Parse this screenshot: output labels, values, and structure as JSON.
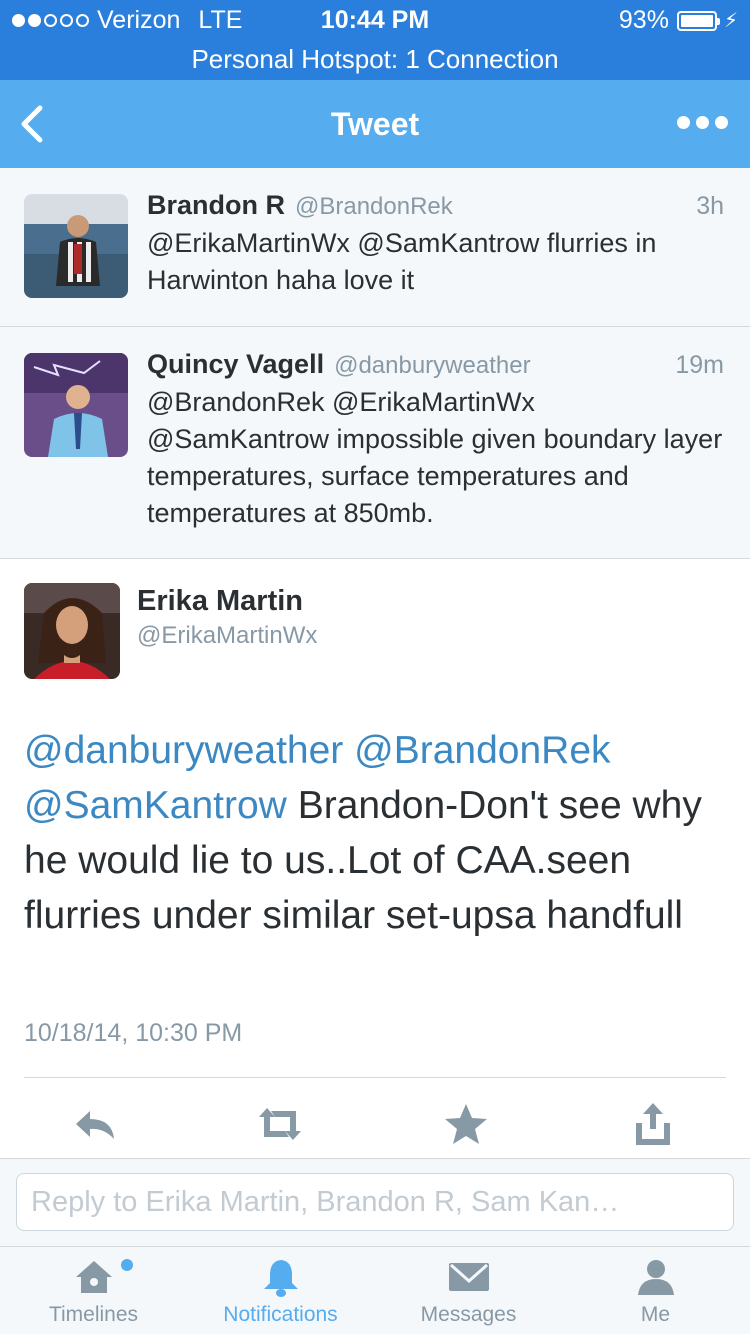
{
  "status_bar": {
    "carrier": "Verizon",
    "network": "LTE",
    "time": "10:44 PM",
    "battery": "93%",
    "battery_level": 0.93
  },
  "hotspot_banner": "Personal Hotspot: 1 Connection",
  "nav": {
    "title": "Tweet"
  },
  "conversation": [
    {
      "name": "Brandon R",
      "handle": "@BrandonRek",
      "time": "3h",
      "text": "@ErikaMartinWx @SamKantrow  flurries in Harwinton haha love it"
    },
    {
      "name": "Quincy Vagell",
      "handle": "@danburyweather",
      "time": "19m",
      "text": "@BrandonRek @ErikaMartinWx @SamKantrow impossible given boundary layer temperatures, surface temperatures and temperatures at 850mb."
    }
  ],
  "main_tweet": {
    "name": "Erika Martin",
    "handle": "@ErikaMartinWx",
    "mention_1": "@danburyweather",
    "mention_2": "@BrandonRek",
    "mention_3": "@SamKantrow",
    "text": "Brandon-Don't see why he would lie to us..Lot of CAA.seen flurries under similar set-upsa handfull",
    "timestamp": "10/18/14, 10:30 PM"
  },
  "reply": {
    "placeholder": "Reply to Erika Martin, Brandon R, Sam Kan…"
  },
  "tabs": [
    {
      "label": "Timelines",
      "icon": "home-icon"
    },
    {
      "label": "Notifications",
      "icon": "bell-icon",
      "active": true
    },
    {
      "label": "Messages",
      "icon": "envelope-icon"
    },
    {
      "label": "Me",
      "icon": "person-icon"
    }
  ],
  "colors": {
    "status_bar": "#2b7fdc",
    "nav_bar": "#55acee",
    "mention": "#3b88c3",
    "muted": "#8899a6",
    "active_tab": "#55acee"
  }
}
